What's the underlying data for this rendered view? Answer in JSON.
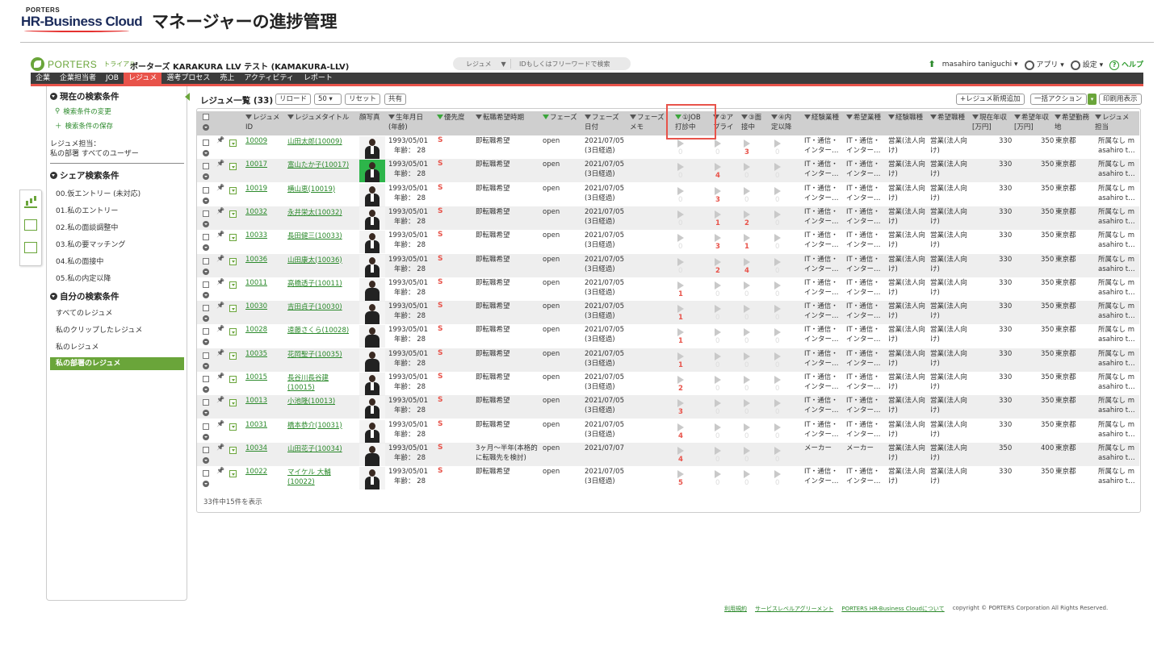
{
  "banner": {
    "brand_small": "PORTERS",
    "brand_main": "HR-Business Cloud",
    "title": "マネージャーの進捗管理"
  },
  "app": {
    "brand": "PORTERS",
    "trial": "トライアル",
    "company": "ポーターズ KARAKURA LLV テスト (KAMAKURA-LLV)",
    "search_scope": "レジュメ",
    "search_placeholder": "IDもしくはフリーワードで検索",
    "user": "masahiro taniguchi",
    "apps_label": "アプリ",
    "settings_label": "設定",
    "help_label": "ヘルプ"
  },
  "nav": [
    "企業",
    "企業担当者",
    "JOB",
    "レジュメ",
    "選考プロセス",
    "売上",
    "アクティビティ",
    "レポート"
  ],
  "nav_active": "レジュメ",
  "sidebar": {
    "current_title": "現在の検索条件",
    "change_link": "検索条件の変更",
    "save_link": "検索条件の保存",
    "owner_label": "レジュメ担当：",
    "owner_value": "私の部署 すべてのユーザー",
    "shared_title": "シェア検索条件",
    "shared_items": [
      "00.仮エントリー (未対応)",
      "01.私のエントリー",
      "02.私の面談調整中",
      "03.私の要マッチング",
      "04.私の面接中",
      "05.私の内定以降"
    ],
    "mine_title": "自分の検索条件",
    "mine_items": [
      "すべてのレジュメ",
      "私のクリップしたレジュメ",
      "私のレジュメ",
      "私の部署のレジュメ"
    ]
  },
  "list": {
    "title": "レジュメ一覧 (33)",
    "reload": "リロード",
    "per_page": "50",
    "reset": "リセット",
    "share": "共有",
    "add_new": "+レジュメ新規追加",
    "bulk": "一括アクション",
    "print": "印刷用表示",
    "footer_count": "33件中15件を表示"
  },
  "columns": {
    "id": [
      "レジュメ",
      "ID"
    ],
    "title": "レジュメタイトル",
    "photo": "顔写真",
    "birth": [
      "生年月日",
      "(年齢)"
    ],
    "priority": "優先度",
    "timing": "転職希望時期",
    "phase": "フェーズ",
    "phase_date": [
      "フェーズ",
      "日付"
    ],
    "phase_memo": [
      "フェーズ",
      "メモ"
    ],
    "job1": [
      "①JOB",
      "打診中"
    ],
    "job2": [
      "②ア",
      "プライ"
    ],
    "job3": [
      "③面",
      "接中"
    ],
    "job4": [
      "④内",
      "定以降"
    ],
    "exp_industry": "経験業種",
    "want_industry": "希望業種",
    "exp_job": "経験職種",
    "want_job": "希望職種",
    "cur_salary": [
      "現在年収",
      "[万円]"
    ],
    "want_salary": [
      "希望年収",
      "[万円]"
    ],
    "location": [
      "希望勤務",
      "地"
    ],
    "owner": [
      "レジュメ",
      "担当"
    ]
  },
  "rows": [
    {
      "id": "10009",
      "name": "山田太郎(10009)",
      "birth": "1993/05/01",
      "age": "年齢： 28",
      "prio": "S",
      "timing": "即転職希望",
      "phase": "open",
      "pdate": "2021/07/05",
      "pdate2": "(3日経過)",
      "c": [
        "0",
        "0",
        "3",
        "0"
      ],
      "ei": "IT・通信・",
      "ei2": "インター…",
      "wi": "IT・通信・",
      "wi2": "インター…",
      "ej": "営業(法人向",
      "ej2": "け)",
      "wj": "営業(法人向",
      "wj2": "け)",
      "cs": "330",
      "ws": "350",
      "loc": "東京都",
      "own": "所属なし m",
      "own2": "asahiro t…",
      "photo": "m"
    },
    {
      "id": "10017",
      "name": "富山たか子(10017)",
      "birth": "1993/05/01",
      "age": "年齢： 28",
      "prio": "S",
      "timing": "即転職希望",
      "phase": "open",
      "pdate": "2021/07/05",
      "pdate2": "(3日経過)",
      "c": [
        "0",
        "4",
        "0",
        "0"
      ],
      "ei": "IT・通信・",
      "ei2": "インター…",
      "wi": "IT・通信・",
      "wi2": "インター…",
      "ej": "営業(法人向",
      "ej2": "け)",
      "wj": "営業(法人向",
      "wj2": "け)",
      "cs": "330",
      "ws": "350",
      "loc": "東京都",
      "own": "所属なし m",
      "own2": "asahiro t…",
      "photo": "g"
    },
    {
      "id": "10019",
      "name": "横山恵(10019)",
      "birth": "1993/05/01",
      "age": "年齢： 28",
      "prio": "S",
      "timing": "即転職希望",
      "phase": "open",
      "pdate": "2021/07/05",
      "pdate2": "(3日経過)",
      "c": [
        "0",
        "3",
        "0",
        "0"
      ],
      "ei": "IT・通信・",
      "ei2": "インター…",
      "wi": "IT・通信・",
      "wi2": "インター…",
      "ej": "営業(法人向",
      "ej2": "け)",
      "wj": "営業(法人向",
      "wj2": "け)",
      "cs": "330",
      "ws": "350",
      "loc": "東京都",
      "own": "所属なし m",
      "own2": "asahiro t…",
      "photo": "m"
    },
    {
      "id": "10032",
      "name": "永井栄太(10032)",
      "birth": "1993/05/01",
      "age": "年齢： 28",
      "prio": "S",
      "timing": "即転職希望",
      "phase": "open",
      "pdate": "2021/07/05",
      "pdate2": "(3日経過)",
      "c": [
        "0",
        "1",
        "2",
        "0"
      ],
      "ei": "IT・通信・",
      "ei2": "インター…",
      "wi": "IT・通信・",
      "wi2": "インター…",
      "ej": "営業(法人向",
      "ej2": "け)",
      "wj": "営業(法人向",
      "wj2": "け)",
      "cs": "330",
      "ws": "350",
      "loc": "東京都",
      "own": "所属なし m",
      "own2": "asahiro t…",
      "photo": "m"
    },
    {
      "id": "10033",
      "name": "長田健三(10033)",
      "birth": "1993/05/01",
      "age": "年齢： 28",
      "prio": "S",
      "timing": "即転職希望",
      "phase": "open",
      "pdate": "2021/07/05",
      "pdate2": "(3日経過)",
      "c": [
        "0",
        "3",
        "1",
        "0"
      ],
      "ei": "IT・通信・",
      "ei2": "インター…",
      "wi": "IT・通信・",
      "wi2": "インター…",
      "ej": "営業(法人向",
      "ej2": "け)",
      "wj": "営業(法人向",
      "wj2": "け)",
      "cs": "330",
      "ws": "350",
      "loc": "東京都",
      "own": "所属なし m",
      "own2": "asahiro t…",
      "photo": "m"
    },
    {
      "id": "10036",
      "name": "山田康太(10036)",
      "birth": "1993/05/01",
      "age": "年齢： 28",
      "prio": "S",
      "timing": "即転職希望",
      "phase": "open",
      "pdate": "2021/07/05",
      "pdate2": "(3日経過)",
      "c": [
        "0",
        "2",
        "4",
        "0"
      ],
      "ei": "IT・通信・",
      "ei2": "インター…",
      "wi": "IT・通信・",
      "wi2": "インター…",
      "ej": "営業(法人向",
      "ej2": "け)",
      "wj": "営業(法人向",
      "wj2": "け)",
      "cs": "330",
      "ws": "350",
      "loc": "東京都",
      "own": "所属なし m",
      "own2": "asahiro t…",
      "photo": "m"
    },
    {
      "id": "10011",
      "name": "高橋透子(10011)",
      "birth": "1993/05/01",
      "age": "年齢： 28",
      "prio": "S",
      "timing": "即転職希望",
      "phase": "open",
      "pdate": "2021/07/05",
      "pdate2": "(3日経過)",
      "c": [
        "1",
        "0",
        "0",
        "0"
      ],
      "ei": "IT・通信・",
      "ei2": "インター…",
      "wi": "IT・通信・",
      "wi2": "インター…",
      "ej": "営業(法人向",
      "ej2": "け)",
      "wj": "営業(法人向",
      "wj2": "け)",
      "cs": "330",
      "ws": "350",
      "loc": "東京都",
      "own": "所属なし m",
      "own2": "asahiro t…",
      "photo": "f"
    },
    {
      "id": "10030",
      "name": "吉田貞子(10030)",
      "birth": "1993/05/01",
      "age": "年齢： 28",
      "prio": "S",
      "timing": "即転職希望",
      "phase": "open",
      "pdate": "2021/07/05",
      "pdate2": "(3日経過)",
      "c": [
        "1",
        "0",
        "0",
        "0"
      ],
      "ei": "IT・通信・",
      "ei2": "インター…",
      "wi": "IT・通信・",
      "wi2": "インター…",
      "ej": "営業(法人向",
      "ej2": "け)",
      "wj": "営業(法人向",
      "wj2": "け)",
      "cs": "330",
      "ws": "350",
      "loc": "東京都",
      "own": "所属なし m",
      "own2": "asahiro t…",
      "photo": "f"
    },
    {
      "id": "10028",
      "name": "遠藤さくら(10028)",
      "birth": "1993/05/01",
      "age": "年齢： 28",
      "prio": "S",
      "timing": "即転職希望",
      "phase": "open",
      "pdate": "2021/07/05",
      "pdate2": "(3日経過)",
      "c": [
        "1",
        "0",
        "0",
        "0"
      ],
      "ei": "IT・通信・",
      "ei2": "インター…",
      "wi": "IT・通信・",
      "wi2": "インター…",
      "ej": "営業(法人向",
      "ej2": "け)",
      "wj": "営業(法人向",
      "wj2": "け)",
      "cs": "330",
      "ws": "350",
      "loc": "東京都",
      "own": "所属なし m",
      "own2": "asahiro t…",
      "photo": "f"
    },
    {
      "id": "10035",
      "name": "花岡聖子(10035)",
      "birth": "1993/05/01",
      "age": "年齢： 28",
      "prio": "S",
      "timing": "即転職希望",
      "phase": "open",
      "pdate": "2021/07/05",
      "pdate2": "(3日経過)",
      "c": [
        "1",
        "0",
        "0",
        "0"
      ],
      "ei": "IT・通信・",
      "ei2": "インター…",
      "wi": "IT・通信・",
      "wi2": "インター…",
      "ej": "営業(法人向",
      "ej2": "け)",
      "wj": "営業(法人向",
      "wj2": "け)",
      "cs": "330",
      "ws": "350",
      "loc": "東京都",
      "own": "所属なし m",
      "own2": "asahiro t…",
      "photo": "f"
    },
    {
      "id": "10015",
      "name": "長谷川長谷建",
      "name2": "(10015)",
      "birth": "1993/05/01",
      "age": "年齢： 28",
      "prio": "S",
      "timing": "即転職希望",
      "phase": "open",
      "pdate": "2021/07/05",
      "pdate2": "(3日経過)",
      "c": [
        "2",
        "0",
        "0",
        "0"
      ],
      "ei": "IT・通信・",
      "ei2": "インター…",
      "wi": "IT・通信・",
      "wi2": "インター…",
      "ej": "営業(法人向",
      "ej2": "け)",
      "wj": "営業(法人向",
      "wj2": "け)",
      "cs": "330",
      "ws": "350",
      "loc": "東京都",
      "own": "所属なし m",
      "own2": "asahiro t…",
      "photo": "m"
    },
    {
      "id": "10013",
      "name": "小池隆(10013)",
      "birth": "1993/05/01",
      "age": "年齢： 28",
      "prio": "S",
      "timing": "即転職希望",
      "phase": "open",
      "pdate": "2021/07/05",
      "pdate2": "(3日経過)",
      "c": [
        "3",
        "0",
        "0",
        "0"
      ],
      "ei": "IT・通信・",
      "ei2": "インター…",
      "wi": "IT・通信・",
      "wi2": "インター…",
      "ej": "営業(法人向",
      "ej2": "け)",
      "wj": "営業(法人向",
      "wj2": "け)",
      "cs": "330",
      "ws": "350",
      "loc": "東京都",
      "own": "所属なし m",
      "own2": "asahiro t…",
      "photo": "m"
    },
    {
      "id": "10031",
      "name": "橋本恭介(10031)",
      "birth": "1993/05/01",
      "age": "年齢： 28",
      "prio": "S",
      "timing": "即転職希望",
      "phase": "open",
      "pdate": "2021/07/05",
      "pdate2": "(3日経過)",
      "c": [
        "4",
        "0",
        "0",
        "0"
      ],
      "ei": "IT・通信・",
      "ei2": "インター…",
      "wi": "IT・通信・",
      "wi2": "インター…",
      "ej": "営業(法人向",
      "ej2": "け)",
      "wj": "営業(法人向",
      "wj2": "け)",
      "cs": "330",
      "ws": "350",
      "loc": "東京都",
      "own": "所属なし m",
      "own2": "asahiro t…",
      "photo": "m"
    },
    {
      "id": "10034",
      "name": "山田花子(10034)",
      "birth": "1993/05/01",
      "age": "年齢： 28",
      "prio": "S",
      "timing": "3ヶ月～半年(本格的",
      "timing2": "に転職先を検討)",
      "phase": "open",
      "pdate": "2021/07/07",
      "pdate2": "",
      "c": [
        "4",
        "0",
        "0",
        "0"
      ],
      "ei": "メーカー",
      "ei2": "",
      "wi": "メーカー",
      "wi2": "",
      "ej": "営業(法人向",
      "ej2": "け)",
      "wj": "営業(法人向",
      "wj2": "け)",
      "cs": "350",
      "ws": "400",
      "loc": "東京都",
      "own": "所属なし m",
      "own2": "asahiro t…",
      "photo": "f"
    },
    {
      "id": "10022",
      "name": "マイケル 大輔",
      "name2": "(10022)",
      "birth": "1993/05/01",
      "age": "年齢： 28",
      "prio": "S",
      "timing": "即転職希望",
      "phase": "open",
      "pdate": "2021/07/05",
      "pdate2": "(3日経過)",
      "c": [
        "5",
        "0",
        "0",
        "0"
      ],
      "ei": "IT・通信・",
      "ei2": "インター…",
      "wi": "IT・通信・",
      "wi2": "インター…",
      "ej": "営業(法人向",
      "ej2": "け)",
      "wj": "営業(法人向",
      "wj2": "け)",
      "cs": "330",
      "ws": "350",
      "loc": "東京都",
      "own": "所属なし m",
      "own2": "asahiro t…",
      "photo": "m"
    }
  ],
  "footer": {
    "terms": "利用規約",
    "sla": "サービスレベルアグリーメント",
    "about": "PORTERS HR-Business Cloudについて",
    "copyright": "copyright © PORTERS Corporation All Rights Reserved."
  }
}
